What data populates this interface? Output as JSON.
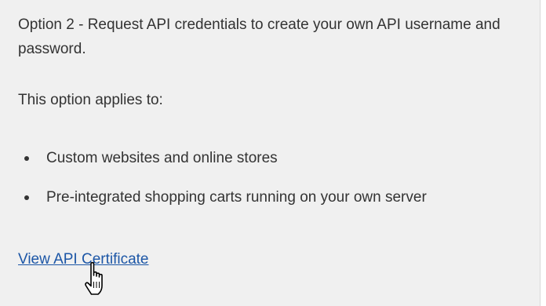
{
  "option": {
    "heading": "Option 2 - Request API credentials to create your own API username and password."
  },
  "applies": {
    "label": "This option applies to:",
    "items": [
      "Custom websites and online stores",
      "Pre-integrated shopping carts running on your own server"
    ]
  },
  "link": {
    "label": "View API Certificate"
  },
  "cursor": {
    "icon": "hand-pointer-icon"
  },
  "colors": {
    "panel_background": "#f0f0f0",
    "text": "#333333",
    "link": "#1c56a6"
  }
}
